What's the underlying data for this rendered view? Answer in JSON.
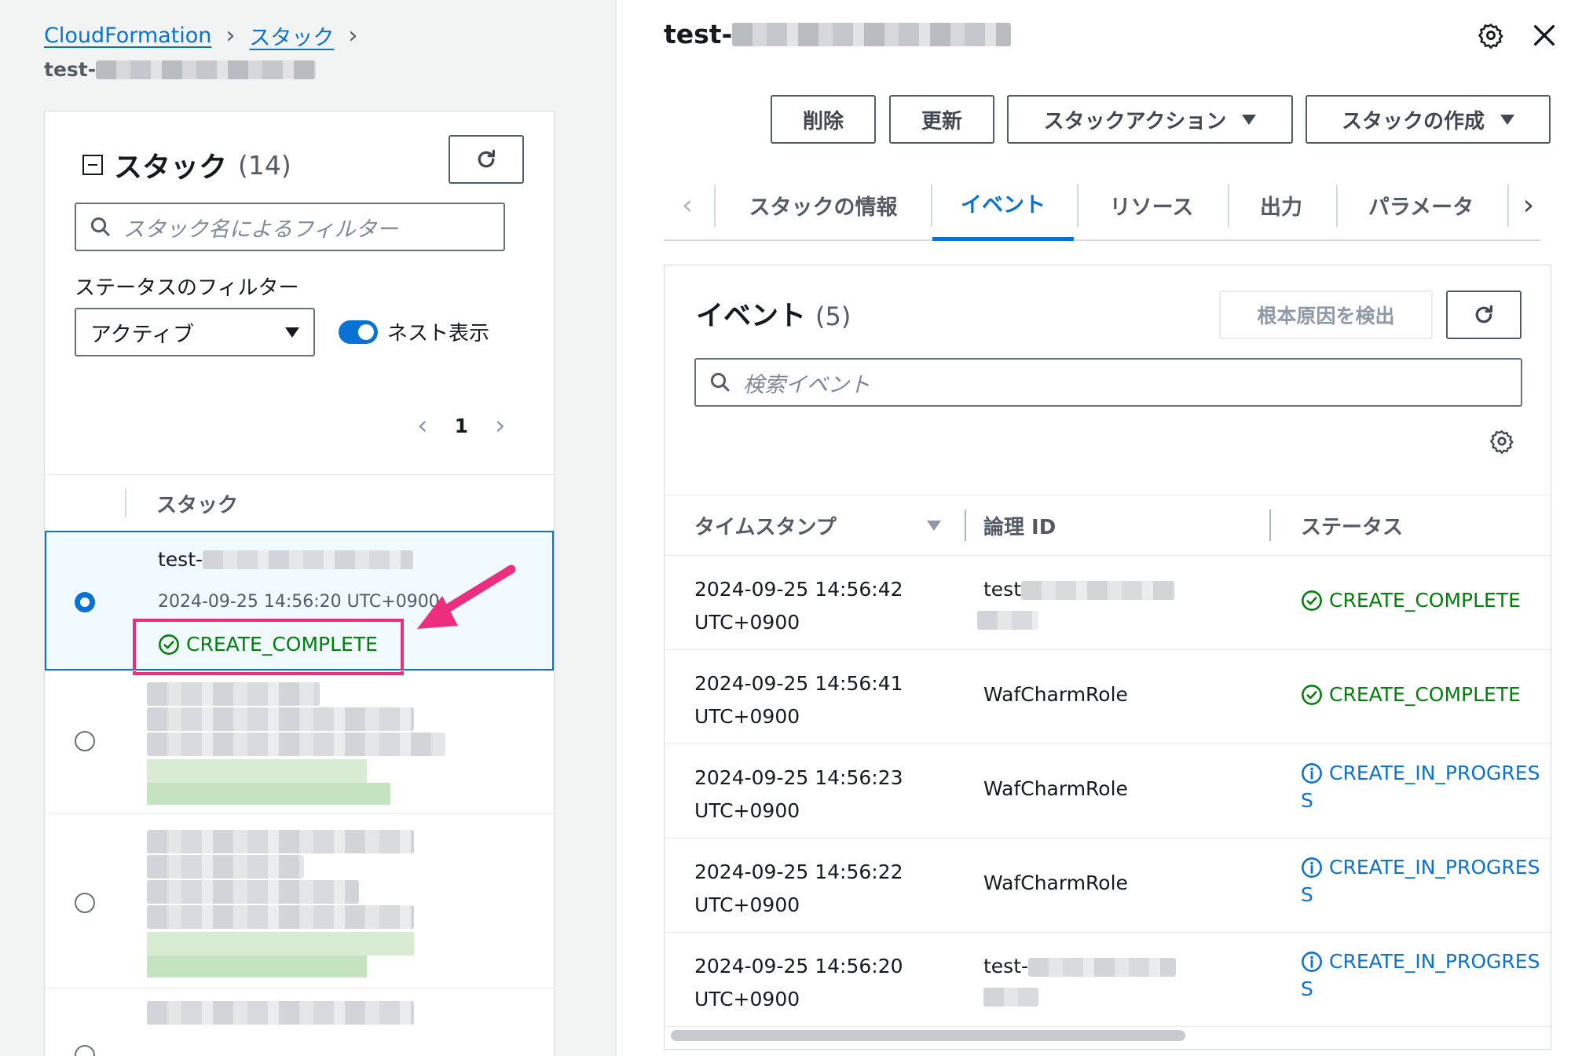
{
  "breadcrumb": {
    "items": [
      "CloudFormation",
      "スタック"
    ],
    "current_prefix": "test-"
  },
  "stacks_panel": {
    "title": "スタック",
    "count": "(14)",
    "search_placeholder": "スタック名によるフィルター",
    "status_filter_label": "ステータスのフィルター",
    "status_filter_value": "アクティブ",
    "nested_toggle_label": "ネスト表示",
    "nested_toggle_on": true,
    "page_number": "1",
    "column_header": "スタック",
    "selected_stack": {
      "name_prefix": "test-",
      "created": "2024-09-25 14:56:20 UTC+0900",
      "status": "CREATE_COMPLETE"
    }
  },
  "detail": {
    "title_prefix": "test-",
    "actions": {
      "delete": "削除",
      "update": "更新",
      "stack_actions": "スタックアクション",
      "create_stack": "スタックの作成"
    },
    "tabs": [
      "スタックの情報",
      "イベント",
      "リソース",
      "出力",
      "パラメータ"
    ],
    "active_tab": "イベント"
  },
  "events_panel": {
    "title": "イベント",
    "count": "(5)",
    "root_cause_button": "根本原因を検出",
    "search_placeholder": "検索イベント",
    "columns": [
      "タイムスタンプ",
      "論理 ID",
      "ステータス"
    ],
    "rows": [
      {
        "date": "2024-09-25 14:56:42",
        "tz": "UTC+0900",
        "logical_id": "test",
        "status": "CREATE_COMPLETE",
        "status_line2": ""
      },
      {
        "date": "2024-09-25 14:56:41",
        "tz": "UTC+0900",
        "logical_id": "WafCharmRole",
        "status": "CREATE_COMPLETE",
        "status_line2": ""
      },
      {
        "date": "2024-09-25 14:56:23",
        "tz": "UTC+0900",
        "logical_id": "WafCharmRole",
        "status": "CREATE_IN_PROGRES",
        "status_line2": "S"
      },
      {
        "date": "2024-09-25 14:56:22",
        "tz": "UTC+0900",
        "logical_id": "WafCharmRole",
        "status": "CREATE_IN_PROGRES",
        "status_line2": "S"
      },
      {
        "date": "2024-09-25 14:56:20",
        "tz": "UTC+0900",
        "logical_id": "test-",
        "status": "CREATE_IN_PROGRES",
        "status_line2": "S"
      }
    ]
  },
  "colors": {
    "link": "#0972d3",
    "success": "#037f0c",
    "highlight": "#ed2e7e"
  }
}
